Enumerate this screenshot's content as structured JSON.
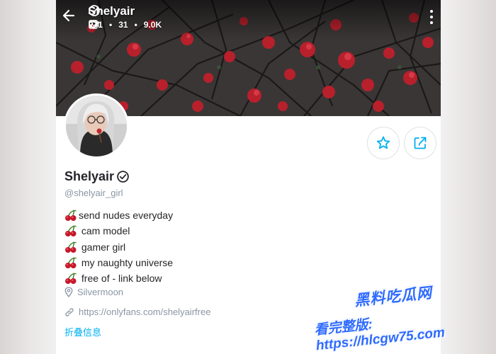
{
  "header": {
    "title": "Shelyair",
    "stats": [
      {
        "icon": "image-icon",
        "value": "271"
      },
      {
        "icon": "video-icon",
        "value": "31"
      },
      {
        "icon": "heart-icon",
        "value": "9.0K"
      }
    ]
  },
  "profile": {
    "name": "Shelyair",
    "handle": "@shelyair_girl",
    "bio": [
      {
        "icon": "cherry-icon",
        "text": "send nudes everyday"
      },
      {
        "icon": "cherry-icon",
        "text": " cam model"
      },
      {
        "icon": "cherry-icon",
        "text": " gamer girl"
      },
      {
        "icon": "cherry-icon",
        "text": " my naughty universe"
      },
      {
        "icon": "cherry-icon",
        "text": " free of - link below"
      }
    ],
    "location": "Silvermoon",
    "link": "https://onlyfans.com/shelyairfree",
    "collapse_label": "折叠信息"
  },
  "watermark": {
    "line1": "黑料吃瓜网",
    "line2": "看完整版: https://hlcgw75.com"
  },
  "colors": {
    "accent": "#00aff0",
    "text": "#242529",
    "muted": "#8a96a3",
    "watermark": "#2f6bff"
  }
}
